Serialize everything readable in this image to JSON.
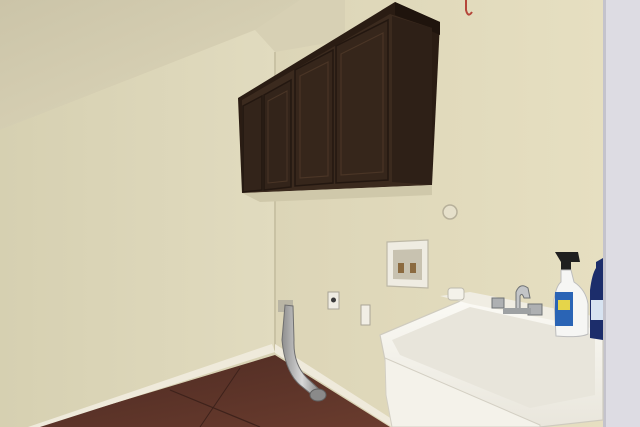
{
  "scene": {
    "kind": "photo",
    "colors": {
      "wall_left": "#dcd6b8",
      "wall_right": "#e3dcbd",
      "ceiling": "#d2cbb0",
      "cabinet": "#3b2a1e",
      "cabinet_dark": "#2a1c13",
      "floor": "#5a3328",
      "trim": "#e9e4d2",
      "sink": "#f4f2ea",
      "door_frame": "#d9d8df"
    },
    "objects": [
      "upper-cabinet",
      "laundry-sink",
      "faucet",
      "spray-bottle",
      "cleaner-bottle",
      "washer-box",
      "dryer-vent",
      "electrical-outlet",
      "light-switch",
      "water-valve",
      "tile-floor",
      "baseboard",
      "door-frame"
    ]
  }
}
